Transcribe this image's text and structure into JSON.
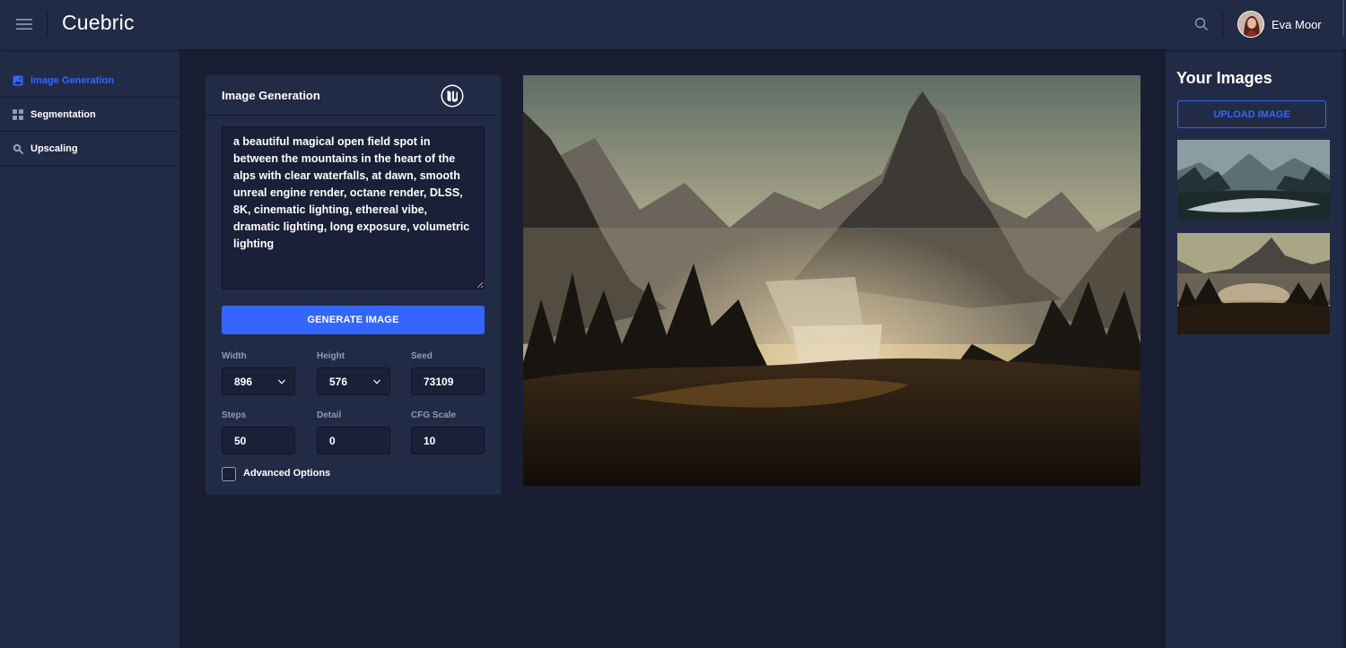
{
  "app": {
    "title": "Cuebric"
  },
  "user": {
    "name": "Eva Moor"
  },
  "icons": {
    "menu": "menu-icon",
    "search": "search-icon",
    "image": "image-icon",
    "grid": "grid-icon",
    "zoom": "zoom-icon",
    "engine": "unreal-engine-logo",
    "chevron": "chevron-down-icon"
  },
  "colors": {
    "accent": "#3366ff",
    "surface": "#222b45",
    "background": "#1a1e33",
    "input": "#192038",
    "muted": "#8f9bb3"
  },
  "sidebar": {
    "items": [
      {
        "label": "Image Generation",
        "icon": "image-icon",
        "active": true
      },
      {
        "label": "Segmentation",
        "icon": "grid-icon",
        "active": false
      },
      {
        "label": "Upscaling",
        "icon": "zoom-icon",
        "active": false
      }
    ]
  },
  "generator": {
    "title": "Image Generation",
    "prompt": "a beautiful magical open field spot in between the mountains in the heart of the alps with clear waterfalls, at dawn, smooth unreal engine render, octane render, DLSS, 8K, cinematic lighting, ethereal vibe, dramatic lighting, long exposure, volumetric lighting",
    "generate_label": "GENERATE IMAGE",
    "width": {
      "label": "Width",
      "value": "896"
    },
    "height": {
      "label": "Height",
      "value": "576"
    },
    "seed": {
      "label": "Seed",
      "value": "73109"
    },
    "steps": {
      "label": "Steps",
      "value": "50"
    },
    "detail": {
      "label": "Detail",
      "value": "0"
    },
    "cfg": {
      "label": "CFG Scale",
      "value": "10"
    },
    "advanced_label": "Advanced Options",
    "advanced_checked": false
  },
  "gallery": {
    "title": "Your Images",
    "upload_label": "UPLOAD IMAGE"
  }
}
